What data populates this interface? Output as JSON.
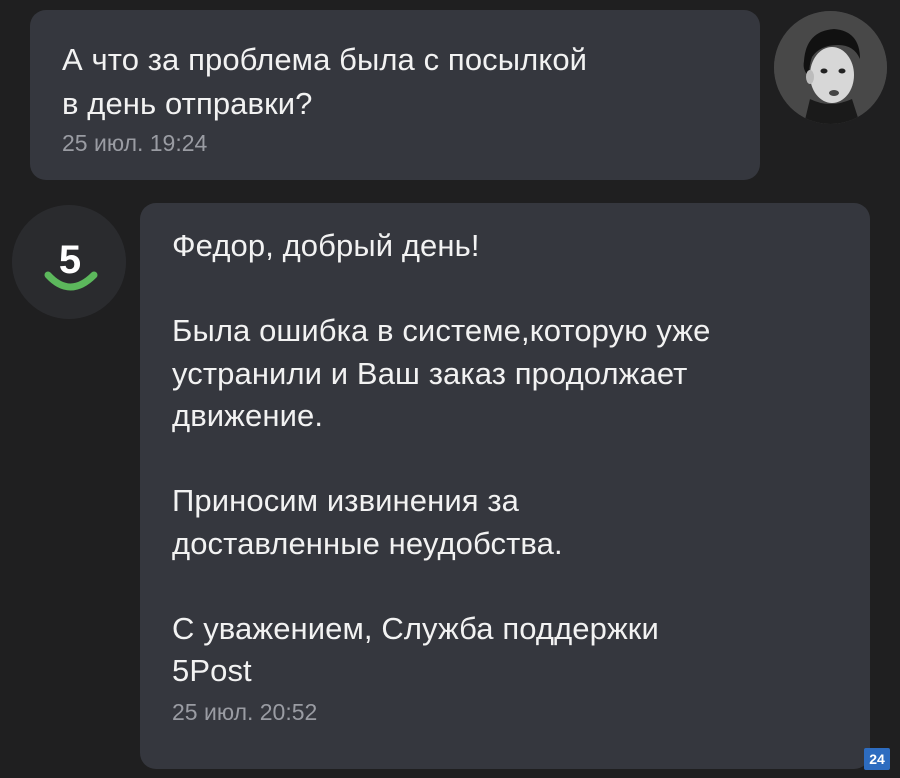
{
  "outgoing_message": {
    "text": "А что за проблема была с посылкой\nв день отправки?",
    "time": "25 июл. 19:24"
  },
  "incoming_message": {
    "text": "Федор, добрый день!\n\nБыла ошибка в системе,которую уже\nустранили и Ваш заказ продолжает\nдвижение.\n\nПриносим извинения за\nдоставленные неудобства.\n\nС уважением, Служба поддержки\n5Post",
    "time": "25 июл. 20:52"
  },
  "support_avatar": {
    "logo_text": "5",
    "accent_color": "#5cb85c"
  },
  "user_avatar": {
    "icon": "user-photo-avatar"
  },
  "watermark": {
    "text": "24"
  }
}
